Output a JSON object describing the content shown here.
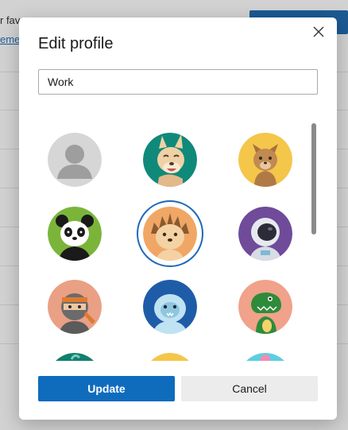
{
  "background": {
    "text_fragment": "r fav",
    "link_fragment": "eme"
  },
  "dialog": {
    "title": "Edit profile",
    "profile_name_value": "Work",
    "close_icon": "close-icon",
    "avatars": [
      {
        "name": "default-person",
        "bg": "#d6d6d6"
      },
      {
        "name": "dog-laughing",
        "bg": "#0f8a7a"
      },
      {
        "name": "cat",
        "bg": "#f4c64a"
      },
      {
        "name": "panda",
        "bg": "#7ab53a"
      },
      {
        "name": "hedgehog",
        "bg": "#f0a766",
        "selected": true
      },
      {
        "name": "astronaut",
        "bg": "#6f4b9a"
      },
      {
        "name": "ninja",
        "bg": "#eaa085"
      },
      {
        "name": "yeti",
        "bg": "#1f5ca8"
      },
      {
        "name": "dinosaur",
        "bg": "#f0a28a"
      },
      {
        "name": "partial-1",
        "bg": "#10806f"
      },
      {
        "name": "partial-2",
        "bg": "#f4c64a"
      },
      {
        "name": "partial-3",
        "bg": "#5ccfe0"
      }
    ],
    "update_label": "Update",
    "cancel_label": "Cancel",
    "accent_color": "#0f6cbd"
  }
}
